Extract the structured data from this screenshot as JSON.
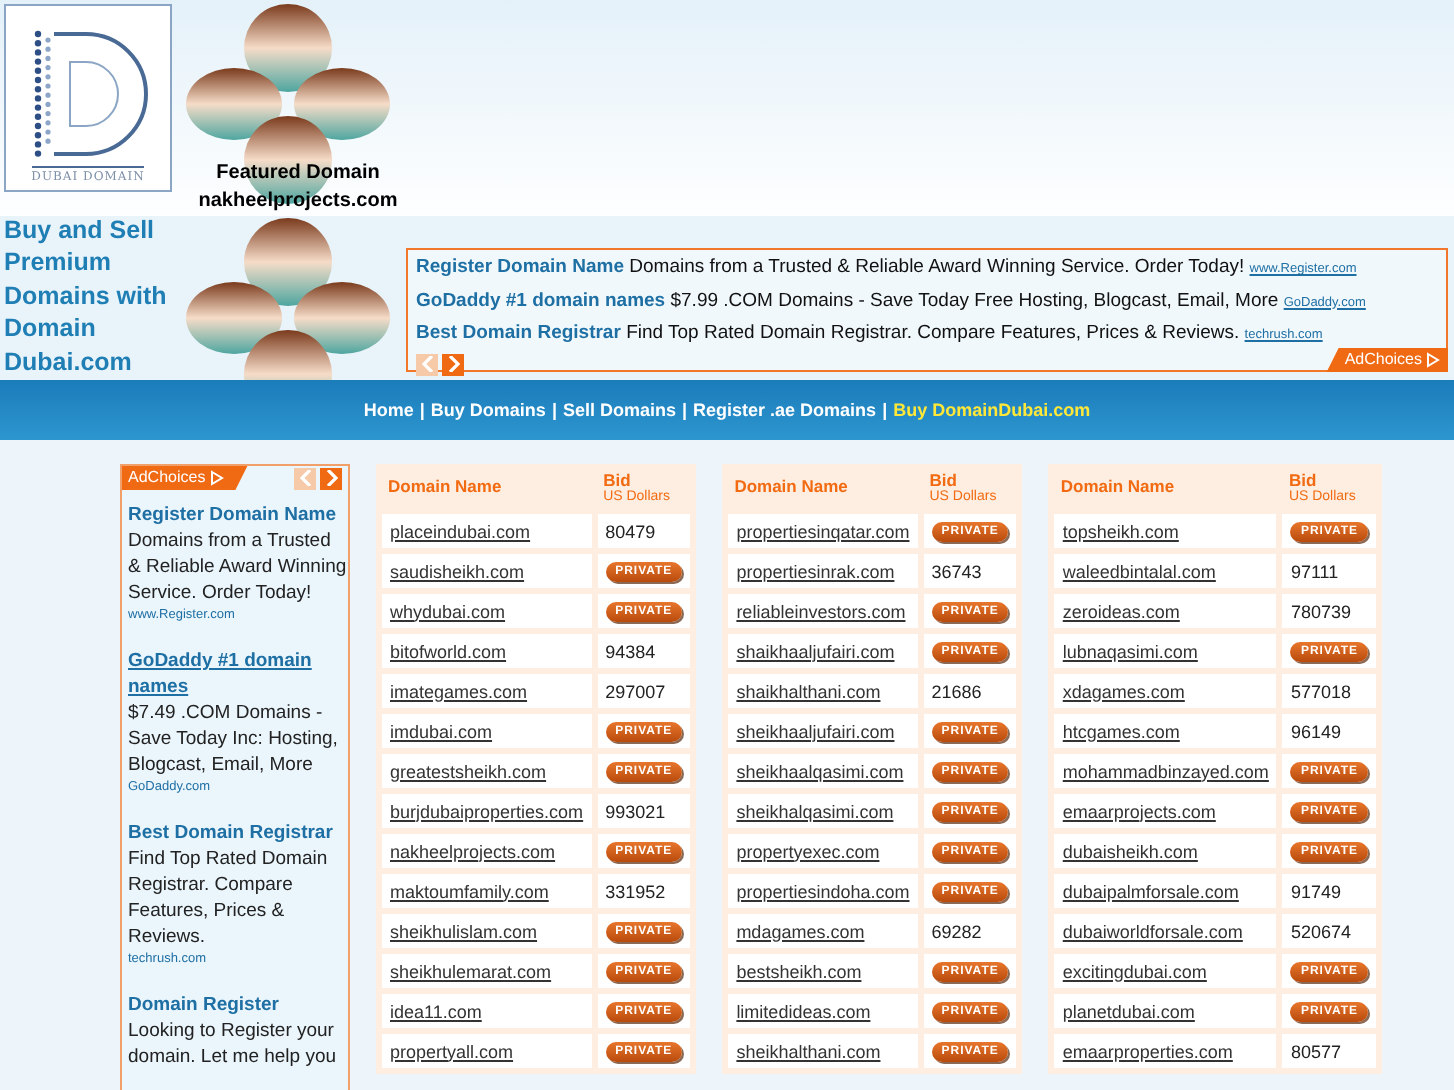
{
  "logo": {
    "caption": "DUBAI DOMAIN"
  },
  "featured": {
    "label": "Featured Domain",
    "domain": "nakheelprojects.com"
  },
  "tagline": "Buy and Sell Premium Domains with Domain Dubai.com",
  "top_ads": {
    "items": [
      {
        "title": "Register Domain Name",
        "body": "Domains from a Trusted & Reliable Award Winning Service. Order Today!",
        "url": "www.Register.com"
      },
      {
        "title": "GoDaddy #1 domain names",
        "body": "$7.99 .COM Domains - Save Today Free Hosting, Blogcast, Email, More",
        "url": "GoDaddy.com"
      },
      {
        "title": "Best Domain Registrar",
        "body": "Find Top Rated Domain Registrar. Compare Features, Prices & Reviews.",
        "url": "techrush.com"
      }
    ],
    "adchoices": "AdChoices"
  },
  "nav": {
    "separator": "|",
    "items": [
      {
        "label": "Home",
        "highlighted": false
      },
      {
        "label": "Buy Domains",
        "highlighted": false
      },
      {
        "label": "Sell Domains",
        "highlighted": false
      },
      {
        "label": "Register .ae Domains",
        "highlighted": false
      },
      {
        "label": "Buy DomainDubai.com",
        "highlighted": true
      }
    ]
  },
  "side_ads": {
    "adchoices": "AdChoices",
    "items": [
      {
        "title": "Register Domain Name",
        "body": "Domains from a Trusted & Reliable Award Winning Service. Order Today!",
        "url": "www.Register.com"
      },
      {
        "title": "GoDaddy #1 domain names",
        "body": "$7.49 .COM Domains - Save Today Inc: Hosting, Blogcast, Email, More",
        "url": "GoDaddy.com"
      },
      {
        "title": "Best Domain Registrar",
        "body": "Find Top Rated Domain Registrar. Compare Features, Prices & Reviews.",
        "url": "techrush.com"
      },
      {
        "title": "Domain Register",
        "body": "Looking to Register your domain. Let me help you"
      }
    ]
  },
  "tables": [
    {
      "columns": {
        "domain": "Domain Name",
        "bid": "Bid",
        "bid_unit": "US Dollars"
      },
      "rows": [
        {
          "domain": "placeindubai.com",
          "bid": {
            "kind": "amount",
            "text": "80479"
          }
        },
        {
          "domain": "saudisheikh.com",
          "bid": {
            "kind": "private",
            "text": "PRIVATE"
          }
        },
        {
          "domain": "whydubai.com",
          "bid": {
            "kind": "private",
            "text": "PRIVATE"
          }
        },
        {
          "domain": "bitofworld.com",
          "bid": {
            "kind": "amount",
            "text": "94384"
          }
        },
        {
          "domain": "imategames.com",
          "bid": {
            "kind": "amount",
            "text": "297007"
          }
        },
        {
          "domain": "imdubai.com",
          "bid": {
            "kind": "private",
            "text": "PRIVATE"
          }
        },
        {
          "domain": "greatestsheikh.com",
          "bid": {
            "kind": "private",
            "text": "PRIVATE"
          }
        },
        {
          "domain": "burjdubaiproperties.com",
          "bid": {
            "kind": "amount",
            "text": "993021"
          }
        },
        {
          "domain": "nakheelprojects.com",
          "bid": {
            "kind": "private",
            "text": "PRIVATE"
          }
        },
        {
          "domain": "maktoumfamily.com",
          "bid": {
            "kind": "amount",
            "text": "331952"
          }
        },
        {
          "domain": "sheikhulislam.com",
          "bid": {
            "kind": "private",
            "text": "PRIVATE"
          }
        },
        {
          "domain": "sheikhulemarat.com",
          "bid": {
            "kind": "private",
            "text": "PRIVATE"
          }
        },
        {
          "domain": "idea11.com",
          "bid": {
            "kind": "private",
            "text": "PRIVATE"
          }
        },
        {
          "domain": "propertyall.com",
          "bid": {
            "kind": "private",
            "text": "PRIVATE"
          }
        }
      ]
    },
    {
      "columns": {
        "domain": "Domain Name",
        "bid": "Bid",
        "bid_unit": "US Dollars"
      },
      "rows": [
        {
          "domain": "propertiesinqatar.com",
          "bid": {
            "kind": "private",
            "text": "PRIVATE"
          }
        },
        {
          "domain": "propertiesinrak.com",
          "bid": {
            "kind": "amount",
            "text": "36743"
          }
        },
        {
          "domain": "reliableinvestors.com",
          "bid": {
            "kind": "private",
            "text": "PRIVATE"
          }
        },
        {
          "domain": "shaikhaaljufairi.com",
          "bid": {
            "kind": "private",
            "text": "PRIVATE"
          }
        },
        {
          "domain": "shaikhalthani.com",
          "bid": {
            "kind": "amount",
            "text": "21686"
          }
        },
        {
          "domain": "sheikhaaljufairi.com",
          "bid": {
            "kind": "private",
            "text": "PRIVATE"
          }
        },
        {
          "domain": "sheikhaalqasimi.com",
          "bid": {
            "kind": "private",
            "text": "PRIVATE"
          }
        },
        {
          "domain": "sheikhalqasimi.com",
          "bid": {
            "kind": "private",
            "text": "PRIVATE"
          }
        },
        {
          "domain": "propertyexec.com",
          "bid": {
            "kind": "private",
            "text": "PRIVATE"
          }
        },
        {
          "domain": "propertiesindoha.com",
          "bid": {
            "kind": "private",
            "text": "PRIVATE"
          }
        },
        {
          "domain": "mdagames.com",
          "bid": {
            "kind": "amount",
            "text": "69282"
          }
        },
        {
          "domain": "bestsheikh.com",
          "bid": {
            "kind": "private",
            "text": "PRIVATE"
          }
        },
        {
          "domain": "limitedideas.com",
          "bid": {
            "kind": "private",
            "text": "PRIVATE"
          }
        },
        {
          "domain": "sheikhalthani.com",
          "bid": {
            "kind": "private",
            "text": "PRIVATE"
          }
        }
      ]
    },
    {
      "columns": {
        "domain": "Domain Name",
        "bid": "Bid",
        "bid_unit": "US Dollars"
      },
      "rows": [
        {
          "domain": "topsheikh.com",
          "bid": {
            "kind": "private",
            "text": "PRIVATE"
          }
        },
        {
          "domain": "waleedbintalal.com",
          "bid": {
            "kind": "amount",
            "text": "97111"
          }
        },
        {
          "domain": "zeroideas.com",
          "bid": {
            "kind": "amount",
            "text": "780739"
          }
        },
        {
          "domain": "lubnaqasimi.com",
          "bid": {
            "kind": "private",
            "text": "PRIVATE"
          }
        },
        {
          "domain": "xdagames.com",
          "bid": {
            "kind": "amount",
            "text": "577018"
          }
        },
        {
          "domain": "htcgames.com",
          "bid": {
            "kind": "amount",
            "text": "96149"
          }
        },
        {
          "domain": "mohammadbinzayed.com",
          "bid": {
            "kind": "private",
            "text": "PRIVATE"
          }
        },
        {
          "domain": "emaarprojects.com",
          "bid": {
            "kind": "private",
            "text": "PRIVATE"
          }
        },
        {
          "domain": "dubaisheikh.com",
          "bid": {
            "kind": "private",
            "text": "PRIVATE"
          }
        },
        {
          "domain": "dubaipalmforsale.com",
          "bid": {
            "kind": "amount",
            "text": "91749"
          }
        },
        {
          "domain": "dubaiworldforsale.com",
          "bid": {
            "kind": "amount",
            "text": "520674"
          }
        },
        {
          "domain": "excitingdubai.com",
          "bid": {
            "kind": "private",
            "text": "PRIVATE"
          }
        },
        {
          "domain": "planetdubai.com",
          "bid": {
            "kind": "private",
            "text": "PRIVATE"
          }
        },
        {
          "domain": "emaarproperties.com",
          "bid": {
            "kind": "amount",
            "text": "80577"
          }
        }
      ]
    }
  ]
}
